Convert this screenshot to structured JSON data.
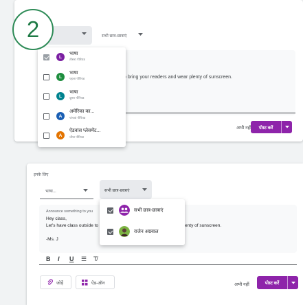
{
  "step_badge": {
    "number": "2"
  },
  "top_card": {
    "students_select": "सभी छात्र-छात्राएं",
    "editor_text": "o bring your readers and wear plenty of sunscreen.",
    "later_label": "अभी नहीं",
    "post_label": "पोस्ट करें",
    "class_menu": [
      {
        "avatar": "L",
        "avatar_color": "#7b1fa2",
        "name": "भाषा",
        "subtitle": "तीसरा पीरियड",
        "checked": true
      },
      {
        "avatar": "L",
        "avatar_color": "#1e8e3e",
        "name": "भाषा",
        "subtitle": "पहला पीरियड",
        "checked": false
      },
      {
        "avatar": "L",
        "avatar_color": "#00838f",
        "name": "भाषा",
        "subtitle": "दूसरा पीरियड",
        "checked": false
      },
      {
        "avatar": "A",
        "avatar_color": "#1a5fb4",
        "name": "अमेरिका का...",
        "subtitle": "पांचवां पीरियड",
        "checked": false
      },
      {
        "avatar": "A",
        "avatar_color": "#e37400",
        "name": "ऐडवांस प्लेसमेंट...",
        "subtitle": "चौथा पीरियड",
        "checked": false
      }
    ]
  },
  "bottom_card": {
    "for_label": "इनके लिए",
    "course_select": "भाषा...",
    "students_select": "सभी छात्र-छात्राएं",
    "editor": {
      "placeholder": "Announce something to you",
      "line1": "Hey class,",
      "line2": "Let's have class outside to",
      "line2_rest": "plenty of sunscreen.",
      "signature": "-Ms. J"
    },
    "format_bold": "B",
    "format_italic": "I",
    "format_underline": "U",
    "format_list": "☰",
    "format_clear": "T̸",
    "attach_label": "जोड़ें",
    "addons_label": "ऐड-ऑन",
    "later_label": "अभी नहीं",
    "post_label": "पोस्ट करें",
    "students_menu": [
      {
        "name": "सभी छात्र-छात्राएं",
        "checked": true,
        "type": "group"
      },
      {
        "name": "राजेन अग्रवाल",
        "checked": true,
        "type": "person"
      }
    ]
  },
  "colors": {
    "accent": "#8e24aa",
    "badge_green": "#2e8b57"
  }
}
